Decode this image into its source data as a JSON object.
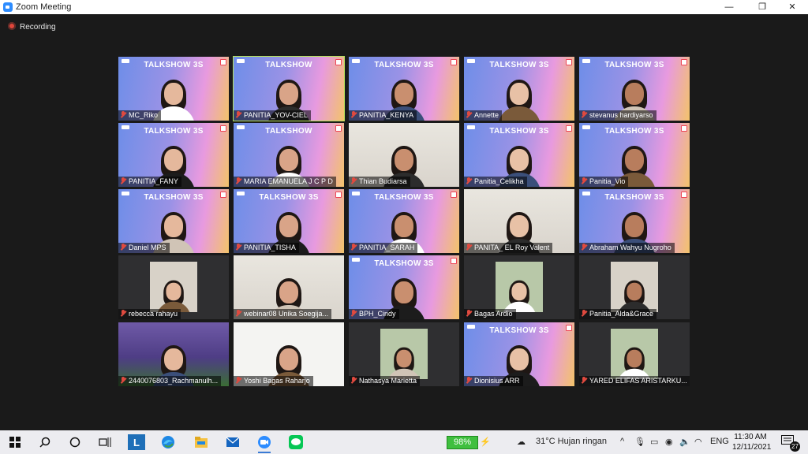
{
  "window": {
    "title": "Zoom Meeting",
    "minimize": "—",
    "maximize": "❐",
    "close": "✕"
  },
  "recording": {
    "label": "Recording"
  },
  "colors": {
    "accent": "#2d8cff",
    "active_speaker": "#b6e35a",
    "mic_muted": "#e04a3f",
    "battery": "#3fbf3f"
  },
  "participants": [
    {
      "name": "MC_Riko",
      "bg": "banner",
      "banner": "TALKSHOW 3S"
    },
    {
      "name": "PANITIA_YOV-CIEL",
      "bg": "banner",
      "banner": "TALKSHOW",
      "active": true
    },
    {
      "name": "PANITIA_KENYA",
      "bg": "banner",
      "banner": "TALKSHOW 3S"
    },
    {
      "name": "Annette",
      "bg": "banner",
      "banner": "TALKSHOW 3S"
    },
    {
      "name": "stevanus hardiyarso",
      "bg": "banner",
      "banner": "TALKSHOW 3S"
    },
    {
      "name": "PANITIA_FANY",
      "bg": "banner",
      "banner": "TALKSHOW 3S"
    },
    {
      "name": "MARIA EMANUELA J C P D",
      "bg": "banner",
      "banner": "TALKSHOW"
    },
    {
      "name": "Thian Budiarsa",
      "bg": "room",
      "banner": ""
    },
    {
      "name": "Panitia_Celikha",
      "bg": "banner",
      "banner": "TALKSHOW 3S"
    },
    {
      "name": "Panitia_Vio",
      "bg": "banner",
      "banner": "TALKSHOW 3S"
    },
    {
      "name": "Daniel MPS",
      "bg": "banner",
      "banner": "TALKSHOW 3S"
    },
    {
      "name": "PANITIA_TISHA",
      "bg": "banner",
      "banner": "TALKSHOW 3S"
    },
    {
      "name": "PANITIA_SARAH",
      "bg": "banner",
      "banner": "TALKSHOW 3S"
    },
    {
      "name": "PANITA_ EL Roy Valent",
      "bg": "room",
      "banner": ""
    },
    {
      "name": "Abraham Wahyu Nugroho",
      "bg": "banner",
      "banner": "TALKSHOW 3S"
    },
    {
      "name": "rebecca rahayu",
      "bg": "thumb",
      "banner": ""
    },
    {
      "name": "webinar08 Unika Soegija...",
      "bg": "room",
      "banner": ""
    },
    {
      "name": "BPH_Cindy",
      "bg": "banner",
      "banner": "TALKSHOW 3S"
    },
    {
      "name": "Bagas Ardio",
      "bg": "thumb",
      "banner": ""
    },
    {
      "name": "Panitia_Alda&Grace",
      "bg": "thumb",
      "banner": ""
    },
    {
      "name": "2440076803_Rachmanulh...",
      "bg": "stadium",
      "banner": ""
    },
    {
      "name": "Yoshi Bagas Raharjo",
      "bg": "white",
      "banner": ""
    },
    {
      "name": "Nathasya Marietta",
      "bg": "thumb",
      "banner": ""
    },
    {
      "name": "Dionisius ARR",
      "bg": "banner",
      "banner": "TALKSHOW 3S"
    },
    {
      "name": "YARED ELIFAS ARISTARKU...",
      "bg": "thumb",
      "banner": ""
    }
  ],
  "taskbar": {
    "apps": [
      "windows-start",
      "search",
      "cortana",
      "task-view",
      "L",
      "edge",
      "file-explorer",
      "mail",
      "zoom",
      "line"
    ],
    "battery": "98%",
    "weather": "31°C  Hujan ringan",
    "chevron": "^",
    "lang": "ENG",
    "time": "11:30 AM",
    "date": "12/11/2021",
    "notifications": "27"
  }
}
